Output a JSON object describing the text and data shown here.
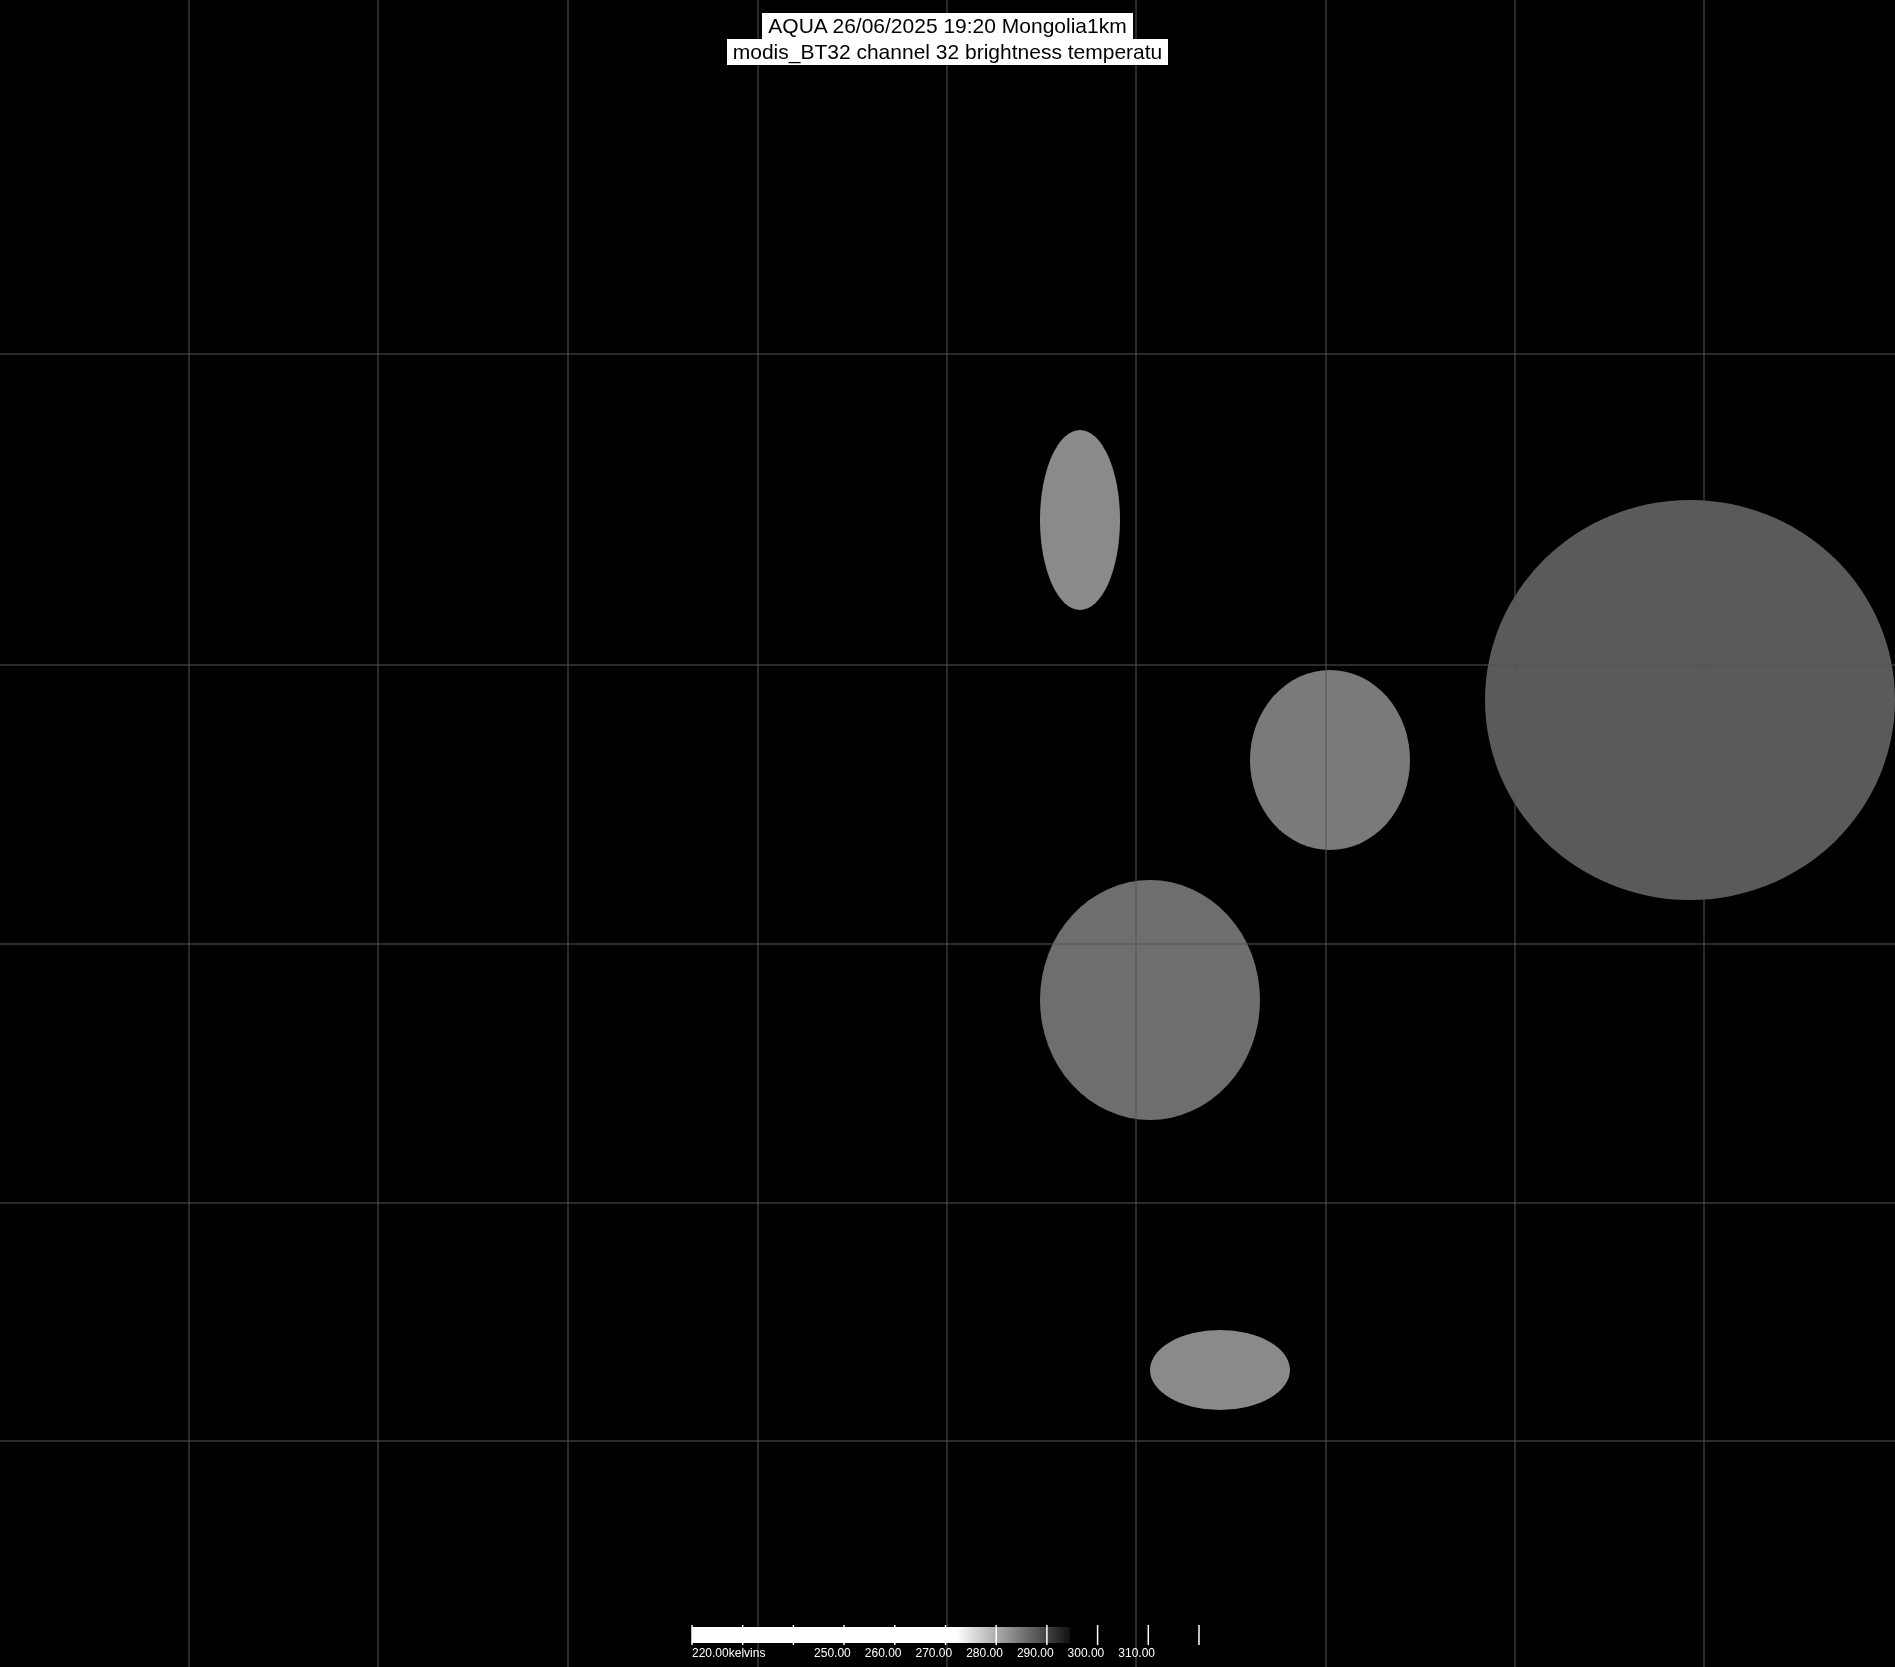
{
  "title_lines": [
    "AQUA 26/06/2025 19:20 Mongolia1km",
    "modis_BT32 channel 32 brightness temperatu"
  ],
  "color_scale": {
    "tick_labels": [
      "220.00kelvins",
      "250.00",
      "260.00",
      "270.00",
      "280.00",
      "290.00",
      "300.00",
      "310.00"
    ]
  }
}
